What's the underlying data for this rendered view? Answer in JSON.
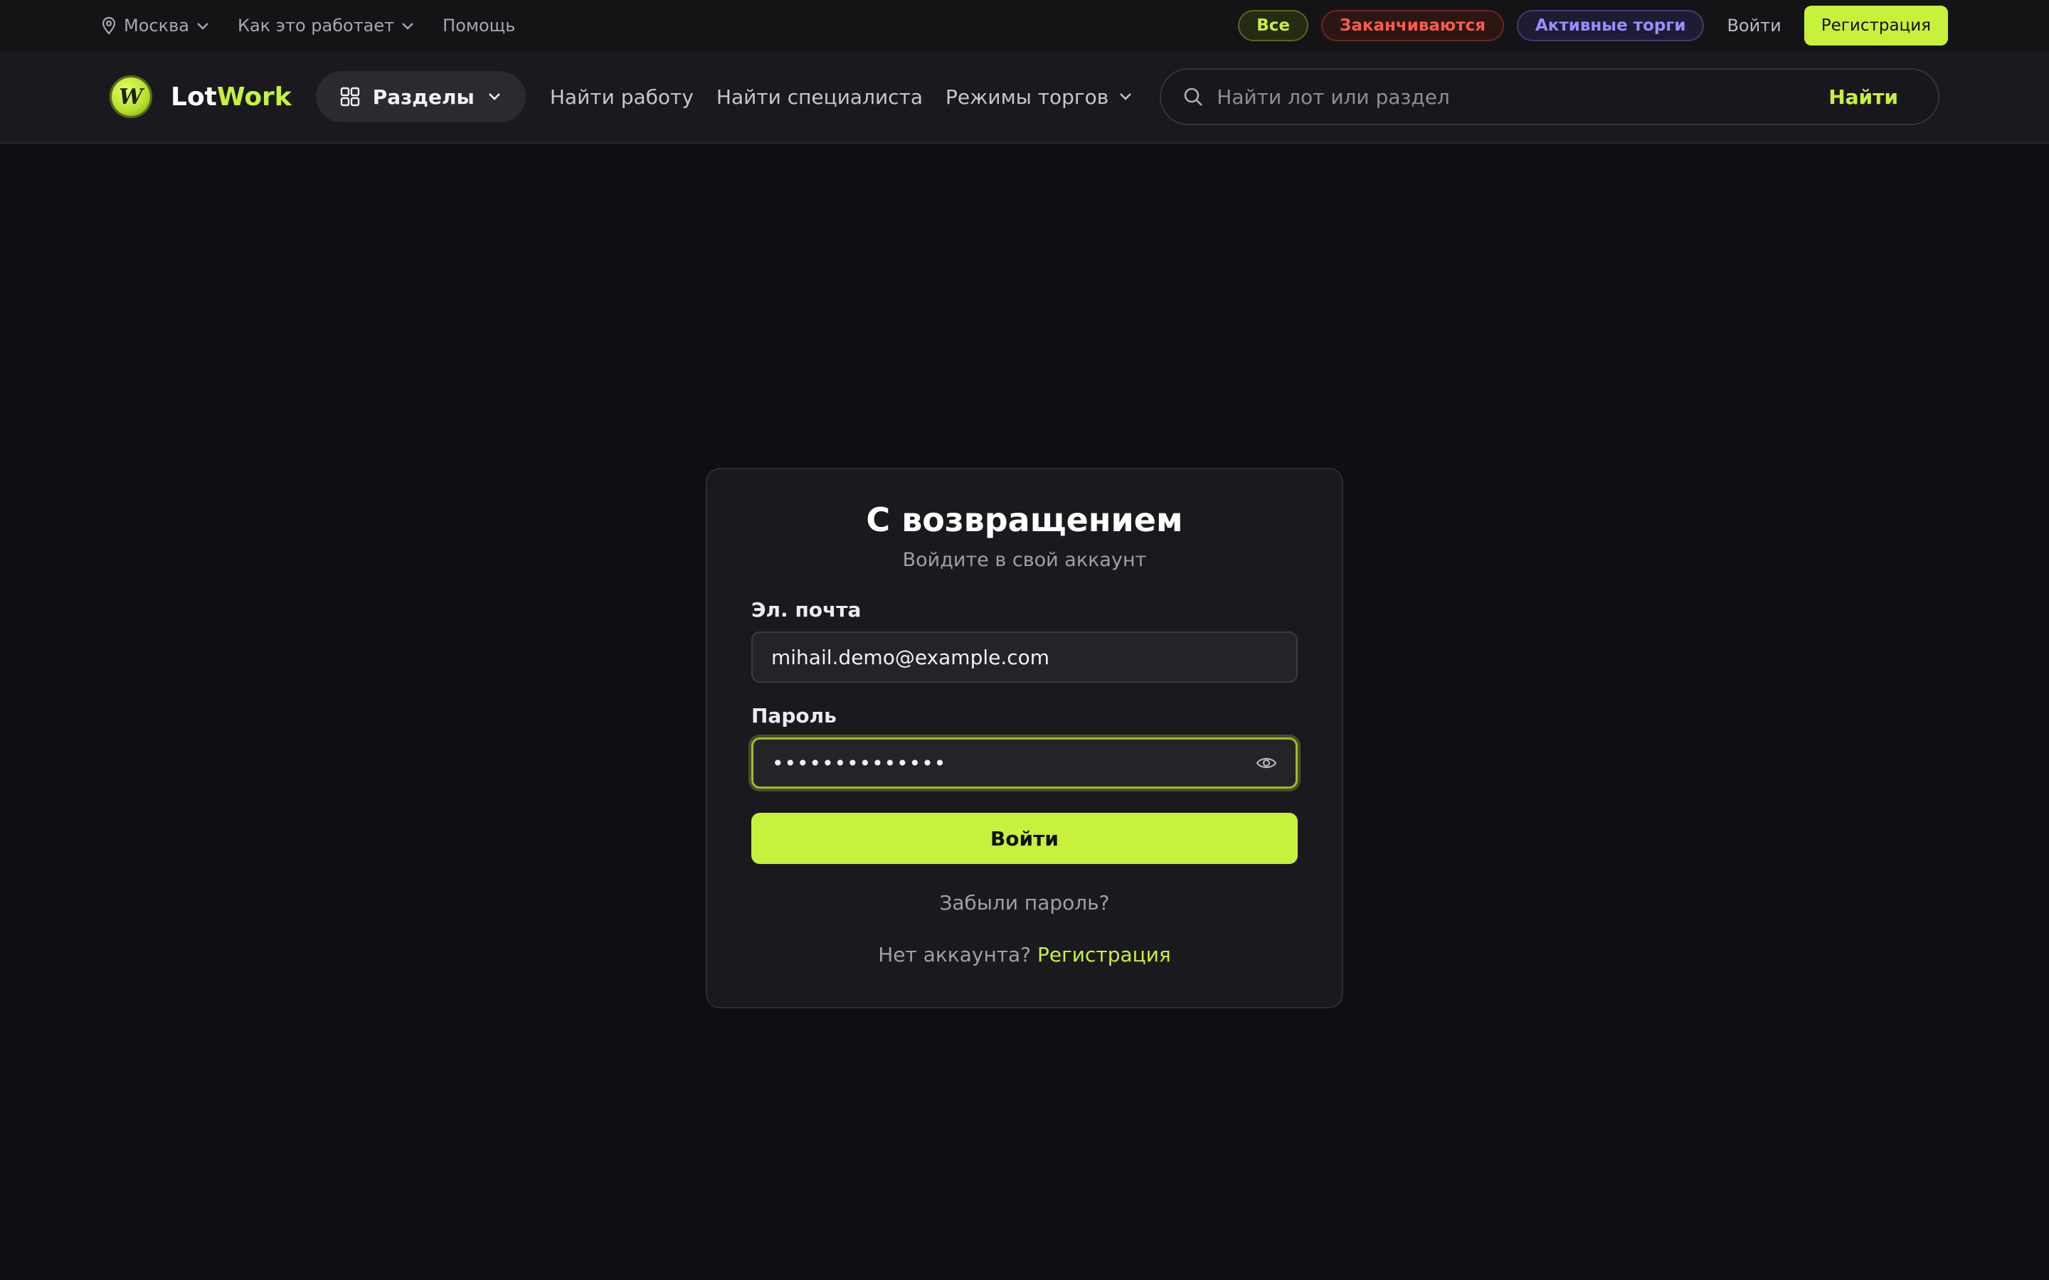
{
  "topbar": {
    "city": "Москва",
    "how_it_works": "Как это работает",
    "help": "Помощь",
    "filters": {
      "all": "Все",
      "ending": "Заканчиваются",
      "active": "Активные торги"
    },
    "login": "Войти",
    "register": "Регистрация"
  },
  "header": {
    "logo_part1": "Lot",
    "logo_part2": "Work",
    "logo_mark": "W",
    "sections": "Разделы",
    "nav": {
      "find_work": "Найти работу",
      "find_specialist": "Найти специалиста",
      "trade_modes": "Режимы торгов"
    },
    "search": {
      "placeholder": "Найти лот или раздел",
      "button": "Найти"
    }
  },
  "login_card": {
    "title": "С возвращением",
    "subtitle": "Войдите в свой аккаунт",
    "email_label": "Эл. почта",
    "email_value": "mihail.demo@example.com",
    "password_label": "Пароль",
    "password_value": "••••••••••••••",
    "submit": "Войти",
    "forgot": "Забыли пароль?",
    "no_account": "Нет аккаунта?",
    "register_link": "Регистрация"
  },
  "colors": {
    "accent": "#c8f13c",
    "background": "#0e0f12",
    "ending_red": "#ff5a4a",
    "active_purple": "#9a8dff"
  },
  "icons": [
    "map-pin-icon",
    "chevron-down-icon",
    "grid-icon",
    "search-icon",
    "eye-icon"
  ]
}
